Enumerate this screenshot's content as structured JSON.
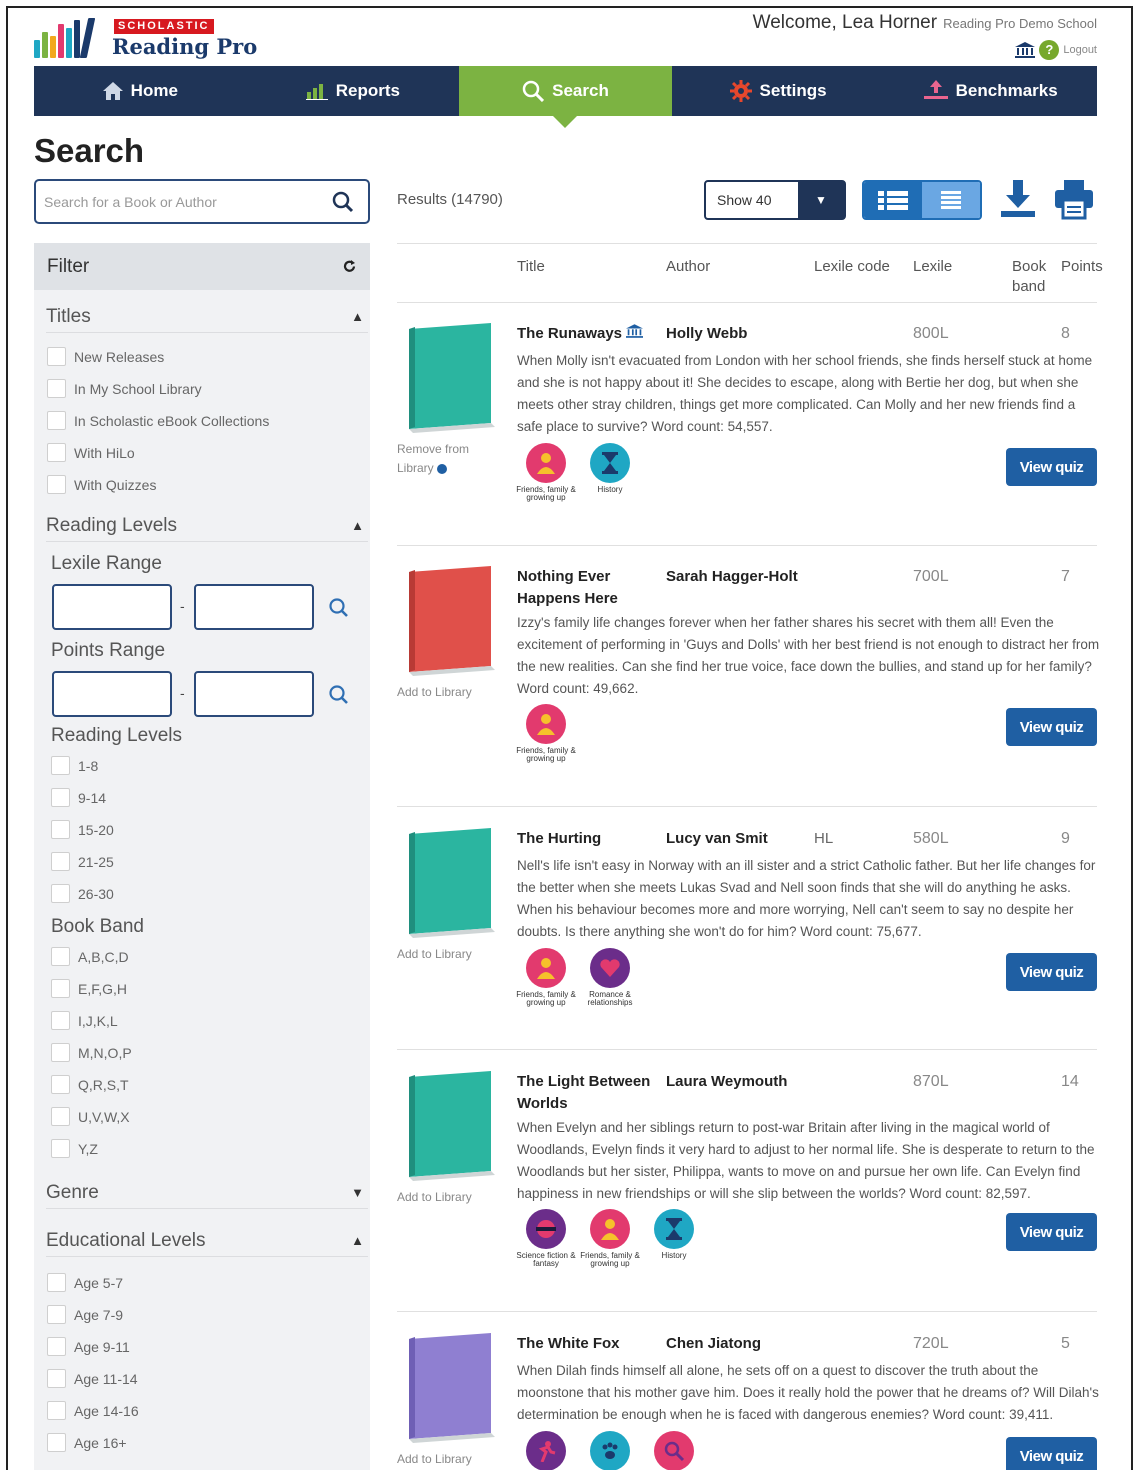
{
  "header": {
    "brand": "SCHOLASTIC",
    "product": "Reading Pro",
    "welcome": "Welcome, Lea Horner",
    "school": "Reading Pro Demo School",
    "logout": "Logout"
  },
  "nav": [
    {
      "label": "Home",
      "icon": "home-icon"
    },
    {
      "label": "Reports",
      "icon": "bar-chart-icon"
    },
    {
      "label": "Search",
      "icon": "search-icon",
      "active": true
    },
    {
      "label": "Settings",
      "icon": "gear-icon"
    },
    {
      "label": "Benchmarks",
      "icon": "upload-icon"
    }
  ],
  "page_title": "Search",
  "search": {
    "placeholder": "Search for a Book or Author",
    "value": ""
  },
  "filter": {
    "title": "Filter",
    "titles": {
      "label": "Titles",
      "options": [
        "New Releases",
        "In My School Library",
        "In Scholastic eBook Collections",
        "With HiLo",
        "With Quizzes"
      ]
    },
    "reading_levels_section": "Reading Levels",
    "lexile_range": "Lexile Range",
    "points_range": "Points Range",
    "reading_levels": {
      "label": "Reading Levels",
      "options": [
        "1-8",
        "9-14",
        "15-20",
        "21-25",
        "26-30"
      ]
    },
    "book_band": {
      "label": "Book Band",
      "options": [
        "A,B,C,D",
        "E,F,G,H",
        "I,J,K,L",
        "M,N,O,P",
        "Q,R,S,T",
        "U,V,W,X",
        "Y,Z"
      ]
    },
    "genre": "Genre",
    "educational_levels": {
      "label": "Educational Levels",
      "options": [
        "Age 5-7",
        "Age 7-9",
        "Age 9-11",
        "Age 11-14",
        "Age 14-16",
        "Age 16+"
      ]
    }
  },
  "results": {
    "count_label": "Results (14790)",
    "show": "Show 40",
    "columns": {
      "title": "Title",
      "author": "Author",
      "lexile_code": "Lexile code",
      "lexile": "Lexile",
      "book_band": "Book band",
      "points": "Points"
    }
  },
  "books": [
    {
      "title": "The Runaways",
      "author": "Holly Webb",
      "lexile_code": "",
      "lexile": "800L",
      "points": "8",
      "library_link": "Remove from Library",
      "cover_color": "#2bb5a0",
      "description": "When Molly isn't evacuated from London with her school friends, she finds herself stuck at home and she is not happy about it! She decides to escape, along with Bertie her dog, but when she meets other stray children, things get more complicated. Can Molly and her new friends find a safe place to survive? Word count: 54,557.",
      "genres": [
        {
          "label": "Friends, family & growing up",
          "color": "#e23a6e",
          "icon": "person-icon"
        },
        {
          "label": "History",
          "color": "#1fa7c4",
          "icon": "hourglass-icon"
        }
      ],
      "quiz": "View quiz"
    },
    {
      "title": "Nothing Ever Happens Here",
      "author": "Sarah Hagger-Holt",
      "lexile_code": "",
      "lexile": "700L",
      "points": "7",
      "library_link": "Add to Library",
      "cover_color": "#e0504a",
      "description": "Izzy's family life changes forever when her father shares his secret with them all! Even the excitement of performing in 'Guys and Dolls' with her best friend is not enough to distract her from the new realities. Can she find her true voice, face down the bullies, and stand up for her family? Word count: 49,662.",
      "genres": [
        {
          "label": "Friends, family & growing up",
          "color": "#e23a6e",
          "icon": "person-icon"
        }
      ],
      "quiz": "View quiz"
    },
    {
      "title": "The Hurting",
      "author": "Lucy van Smit",
      "lexile_code": "HL",
      "lexile": "580L",
      "points": "9",
      "library_link": "Add to Library",
      "cover_color": "#2bb5a0",
      "description": "Nell's life isn't easy in Norway with an ill sister and a strict Catholic father. But her life changes for the better when she meets Lukas Svad and Nell soon finds that she will do anything he asks. When his behaviour becomes more and more worrying, Nell can't seem to say no despite her doubts. Is there anything she won't do for him? Word count: 75,677.",
      "genres": [
        {
          "label": "Friends, family & growing up",
          "color": "#e23a6e",
          "icon": "person-icon"
        },
        {
          "label": "Romance & relationships",
          "color": "#6b2d8a",
          "icon": "heart-icon"
        }
      ],
      "quiz": "View quiz"
    },
    {
      "title": "The Light Between Worlds",
      "author": "Laura Weymouth",
      "lexile_code": "",
      "lexile": "870L",
      "points": "14",
      "library_link": "Add to Library",
      "cover_color": "#2bb5a0",
      "description": "When Evelyn and her siblings return to post-war Britain after living in the magical world of Woodlands, Evelyn finds it very hard to adjust to her normal life. She is desperate to return to the Woodlands but her sister, Philippa, wants to move on and pursue her own life. Can Evelyn find happiness in new friendships or will she slip between the worlds? Word count: 82,597.",
      "genres": [
        {
          "label": "Science fiction & fantasy",
          "color": "#6b2d8a",
          "icon": "planet-icon"
        },
        {
          "label": "Friends, family & growing up",
          "color": "#e23a6e",
          "icon": "person-icon"
        },
        {
          "label": "History",
          "color": "#1fa7c4",
          "icon": "hourglass-icon"
        }
      ],
      "quiz": "View quiz"
    },
    {
      "title": "The White Fox",
      "author": "Chen Jiatong",
      "lexile_code": "",
      "lexile": "720L",
      "points": "5",
      "library_link": "Add to Library",
      "cover_color": "#8f7fd1",
      "description": "When Dilah finds himself all alone, he sets off on a quest to discover the truth about the moonstone that his mother gave him. Does it really hold the power that he dreams of? Will Dilah's determination be enough when he is faced with dangerous enemies? Word count: 39,411.",
      "genres": [
        {
          "label": "",
          "color": "#6b2d8a",
          "icon": "runner-icon"
        },
        {
          "label": "",
          "color": "#1fa7c4",
          "icon": "paw-icon"
        },
        {
          "label": "",
          "color": "#e23a6e",
          "icon": "magnifier-icon"
        }
      ],
      "quiz": "View quiz"
    }
  ],
  "colors": {
    "navy": "#1f3457",
    "green": "#7cb342",
    "blue": "#1f5fa3",
    "magenta": "#e23a6e",
    "teal": "#1fa7c4",
    "purple": "#6b2d8a"
  }
}
